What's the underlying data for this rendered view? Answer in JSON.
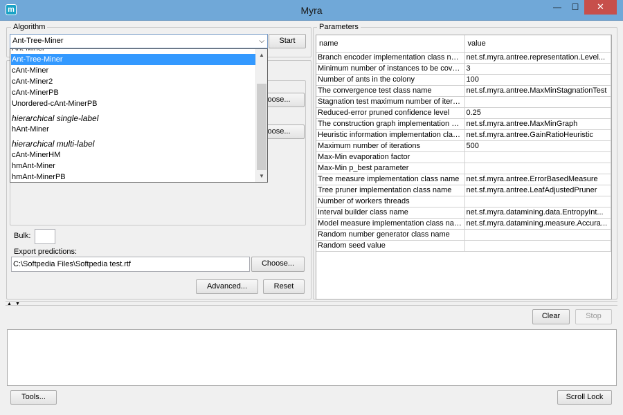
{
  "window": {
    "title": "Myra",
    "app_icon": "m",
    "minimize_glyph": "—",
    "maximize_glyph": "☐",
    "close_glyph": "✕"
  },
  "algorithm": {
    "group_label": "Algorithm",
    "selected_value": "Ant-Tree-Miner",
    "start_label": "Start",
    "choose_label_1": "oose...",
    "choose_label_2": "oose...",
    "dropdown": {
      "partial_top": "Ant-Miner",
      "items": [
        {
          "label": "Ant-Tree-Miner",
          "kind": "item",
          "selected": true
        },
        {
          "label": "cAnt-Miner",
          "kind": "item"
        },
        {
          "label": "cAnt-Miner2",
          "kind": "item"
        },
        {
          "label": "cAnt-MinerPB",
          "kind": "item"
        },
        {
          "label": "Unordered-cAnt-MinerPB",
          "kind": "item"
        },
        {
          "label": "hierarchical single-label",
          "kind": "header"
        },
        {
          "label": "hAnt-Miner",
          "kind": "item"
        },
        {
          "label": "hierarchical multi-label",
          "kind": "header"
        },
        {
          "label": "cAnt-MinerHM",
          "kind": "item"
        },
        {
          "label": "hmAnt-Miner",
          "kind": "item"
        },
        {
          "label": "hmAnt-MinerPB",
          "kind": "item"
        }
      ]
    }
  },
  "bulk": {
    "label": "Bulk:",
    "value": ""
  },
  "export": {
    "label": "Export predictions:",
    "value": "C:\\Softpedia Files\\Softpedia test.rtf",
    "choose_label": "Choose..."
  },
  "actions": {
    "advanced_label": "Advanced...",
    "reset_label": "Reset"
  },
  "parameters": {
    "group_label": "Parameters",
    "columns": [
      "name",
      "value"
    ],
    "rows": [
      [
        "Branch encoder implementation class name",
        "net.sf.myra.antree.representation.Level..."
      ],
      [
        "Minimum number of instances to be cover...",
        "3"
      ],
      [
        "Number of ants in the colony",
        "100"
      ],
      [
        "The convergence test class name",
        "net.sf.myra.antree.MaxMinStagnationTest"
      ],
      [
        "Stagnation test maximum number of itera...",
        ""
      ],
      [
        "Reduced-error pruned confidence level",
        "0.25"
      ],
      [
        "The construction graph implementation cl...",
        "net.sf.myra.antree.MaxMinGraph"
      ],
      [
        "Heuristic information implementation clas...",
        "net.sf.myra.antree.GainRatioHeuristic"
      ],
      [
        "Maximum number of iterations",
        "500"
      ],
      [
        "Max-Min evaporation factor",
        ""
      ],
      [
        "Max-Min p_best parameter",
        ""
      ],
      [
        "Tree measure implementation class name",
        "net.sf.myra.antree.ErrorBasedMeasure"
      ],
      [
        "Tree pruner implementation class name",
        "net.sf.myra.antree.LeafAdjustedPruner"
      ],
      [
        "Number of workers threads",
        ""
      ],
      [
        "Interval builder class name",
        "net.sf.myra.datamining.data.EntropyInt..."
      ],
      [
        "Model measure implementation class name",
        "net.sf.myra.datamining.measure.Accura..."
      ],
      [
        "Random number generator class name",
        ""
      ],
      [
        "Random seed value",
        ""
      ]
    ]
  },
  "console": {
    "clear_label": "Clear",
    "stop_label": "Stop",
    "tools_label": "Tools...",
    "scroll_lock_label": "Scroll Lock"
  },
  "colors": {
    "titlebar": "#70a8d8",
    "close_button": "#c74f4b",
    "selection": "#3399ff"
  }
}
